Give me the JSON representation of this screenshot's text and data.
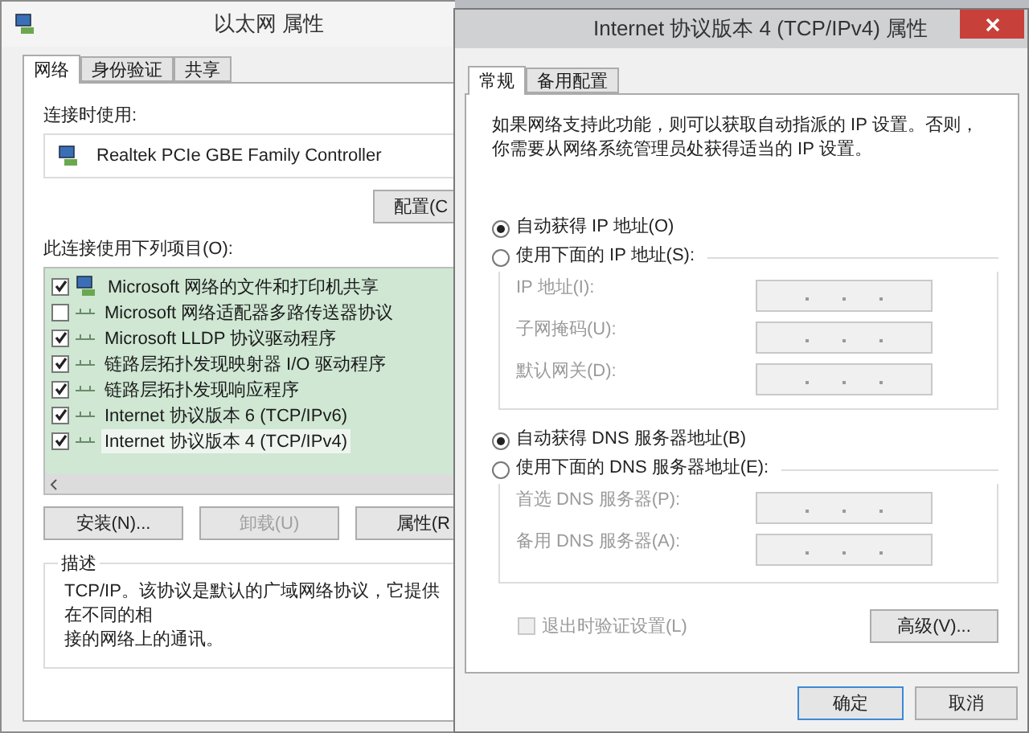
{
  "back_window": {
    "title": "以太网 属性",
    "tabs": [
      {
        "label": "网络",
        "selected": true
      },
      {
        "label": "身份验证",
        "selected": false
      },
      {
        "label": "共享",
        "selected": false
      }
    ],
    "connect_using_label": "连接时使用:",
    "adapter": "Realtek PCIe GBE Family Controller",
    "configure_button": "配置(C",
    "items_label": "此连接使用下列项目(O):",
    "items": [
      {
        "label": "Microsoft 网络的文件和打印机共享",
        "checked": true,
        "selected": false,
        "kind": "service"
      },
      {
        "label": "Microsoft 网络适配器多路传送器协议",
        "checked": false,
        "selected": false,
        "kind": "protocol"
      },
      {
        "label": "Microsoft LLDP 协议驱动程序",
        "checked": true,
        "selected": false,
        "kind": "protocol"
      },
      {
        "label": "链路层拓扑发现映射器 I/O 驱动程序",
        "checked": true,
        "selected": false,
        "kind": "protocol"
      },
      {
        "label": "链路层拓扑发现响应程序",
        "checked": true,
        "selected": false,
        "kind": "protocol"
      },
      {
        "label": "Internet 协议版本 6 (TCP/IPv6)",
        "checked": true,
        "selected": false,
        "kind": "protocol"
      },
      {
        "label": "Internet 协议版本 4 (TCP/IPv4)",
        "checked": true,
        "selected": true,
        "kind": "protocol"
      }
    ],
    "buttons": [
      {
        "label": "安装(N)...",
        "disabled": false
      },
      {
        "label": "卸载(U)",
        "disabled": true
      },
      {
        "label": "属性(R",
        "disabled": false
      }
    ],
    "description": {
      "legend": "描述",
      "lines": [
        "TCP/IP。该协议是默认的广域网络协议，它提供在不同的相",
        "接的网络上的通讯。"
      ]
    }
  },
  "front_window": {
    "title": "Internet 协议版本 4 (TCP/IPv4) 属性",
    "tabs": [
      {
        "label": "常规",
        "selected": true
      },
      {
        "label": "备用配置",
        "selected": false
      }
    ],
    "intro": "如果网络支持此功能，则可以获取自动指派的 IP 设置。否则，你需要从网络系统管理员处获得适当的 IP 设置。",
    "ip_options": [
      {
        "label": "自动获得 IP 地址(O)",
        "selected": true
      },
      {
        "label": "使用下面的 IP 地址(S):",
        "selected": false
      }
    ],
    "ip_fields": [
      {
        "label": "IP 地址(I):",
        "disabled": true
      },
      {
        "label": "子网掩码(U):",
        "disabled": true
      },
      {
        "label": "默认网关(D):",
        "disabled": true
      }
    ],
    "dns_options": [
      {
        "label": "自动获得 DNS 服务器地址(B)",
        "selected": true
      },
      {
        "label": "使用下面的 DNS 服务器地址(E):",
        "selected": false
      }
    ],
    "dns_fields": [
      {
        "label": "首选 DNS 服务器(P):",
        "disabled": true
      },
      {
        "label": "备用 DNS 服务器(A):",
        "disabled": true
      }
    ],
    "validate": {
      "label": "退出时验证设置(L)",
      "checked": false,
      "disabled": true
    },
    "advanced_button": "高级(V)...",
    "ok_button": "确定",
    "cancel_button": "取消"
  }
}
